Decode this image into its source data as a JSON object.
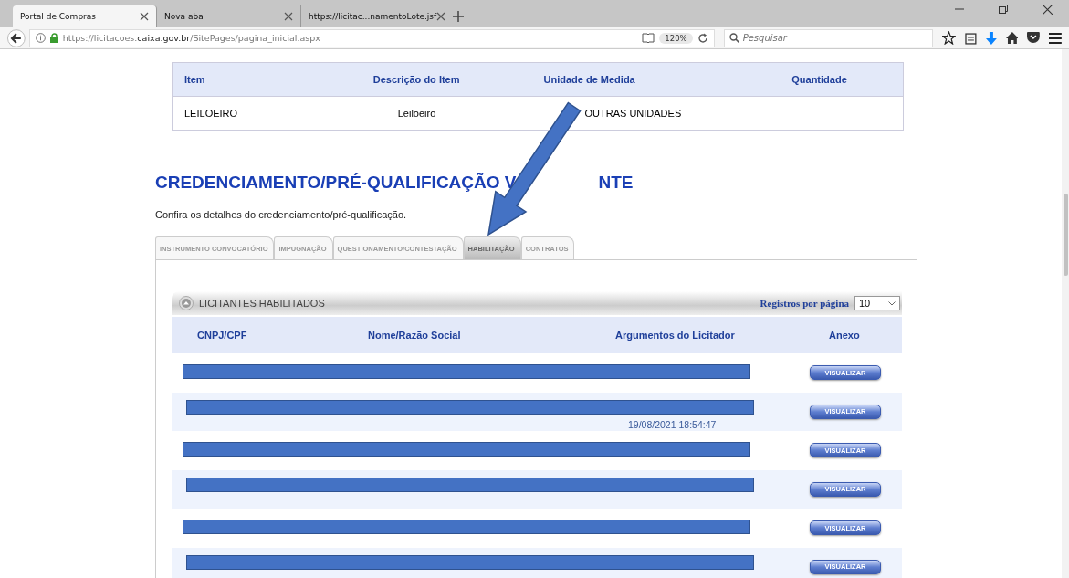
{
  "browser": {
    "tabs": [
      {
        "label": "Portal de Compras",
        "selected": true
      },
      {
        "label": "Nova aba",
        "selected": false
      },
      {
        "label": "https://licitac...namentoLote.jsf",
        "selected": false
      }
    ],
    "url": {
      "prefix": "https://licitacoes.",
      "domain": "caixa.gov.br",
      "path": "/SitePages/pagina_inicial.aspx"
    },
    "zoom": "120%",
    "search": {
      "placeholder": "Pesquisar"
    }
  },
  "items_table": {
    "columns": [
      "Item",
      "Descrição do Item",
      "Unidade de Medida",
      "Quantidade"
    ],
    "rows": [
      [
        "LEILOEIRO",
        "Leiloeiro",
        "OUTRAS UNIDADES",
        ""
      ]
    ]
  },
  "heading": [
    "CREDENCIAMENTO/PRÉ-QUALIFICAÇÃO V",
    "NTE"
  ],
  "subtitle": "Confira os detalhes do credenciamento/pré-qualificação.",
  "tabs": [
    {
      "label": "INSTRUMENTO CONVOCATÓRIO",
      "selected": false
    },
    {
      "label": "IMPUGNAÇÃO",
      "selected": false
    },
    {
      "label": "QUESTIONAMENTO/CONTESTAÇÃO",
      "selected": false
    },
    {
      "label": "HABILITAÇÃO",
      "selected": true
    },
    {
      "label": "CONTRATOS",
      "selected": false
    }
  ],
  "section": {
    "title": "LICITANTES HABILITADOS",
    "page_size_label": "Registros por página",
    "page_size": "10"
  },
  "bidders": {
    "columns": [
      "CNPJ/CPF",
      "Nome/Razão Social",
      "Argumentos do Licitador",
      "Anexo"
    ],
    "rows": [
      {
        "button": "VISUALIZAR",
        "redacted": true
      },
      {
        "argument": "19/08/2021 18:54:47",
        "button": "VISUALIZAR",
        "redacted": true
      },
      {
        "button": "VISUALIZAR",
        "redacted": true
      },
      {
        "button": "VISUALIZAR",
        "redacted": true
      },
      {
        "button": "VISUALIZAR",
        "redacted": true
      },
      {
        "button": "VISUALIZAR",
        "redacted": true
      }
    ]
  }
}
